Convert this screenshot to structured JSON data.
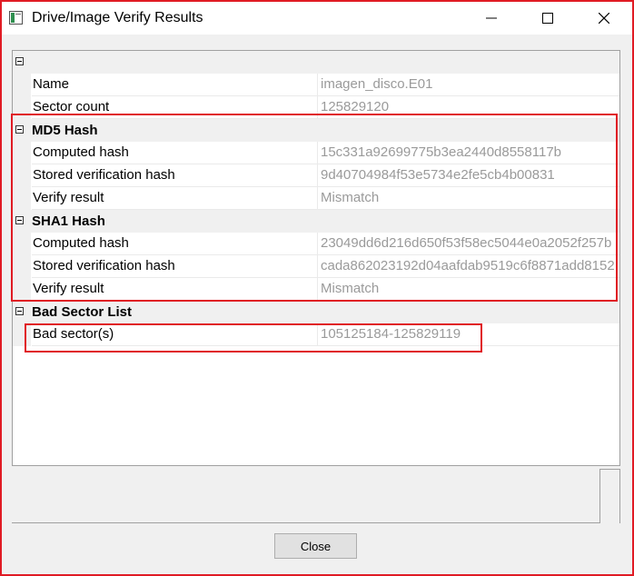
{
  "window": {
    "title": "Drive/Image Verify Results",
    "icons": {
      "app": "app-window-icon",
      "minimize": "minimize-icon",
      "maximize": "maximize-icon",
      "close": "close-icon"
    }
  },
  "properties": {
    "general": {
      "rows": [
        {
          "name": "Name",
          "value": "imagen_disco.E01"
        },
        {
          "name": "Sector count",
          "value": "125829120"
        }
      ]
    },
    "md5": {
      "label": "MD5 Hash",
      "rows": [
        {
          "name": "Computed hash",
          "value": "15c331a92699775b3ea2440d8558117b"
        },
        {
          "name": "Stored verification hash",
          "value": "9d40704984f53e5734e2fe5cb4b00831"
        },
        {
          "name": "Verify result",
          "value": "Mismatch"
        }
      ]
    },
    "sha1": {
      "label": "SHA1 Hash",
      "rows": [
        {
          "name": "Computed hash",
          "value": "23049dd6d216d650f53f58ec5044e0a2052f257b"
        },
        {
          "name": "Stored verification hash",
          "value": "cada862023192d04aafdab9519c6f8871add8152"
        },
        {
          "name": "Verify result",
          "value": "Mismatch"
        }
      ]
    },
    "bad_sectors": {
      "label": "Bad Sector List",
      "rows": [
        {
          "name": "Bad sector(s)",
          "value": "105125184-125829119"
        }
      ]
    }
  },
  "buttons": {
    "close_label": "Close"
  },
  "colors": {
    "highlight": "#e01b24",
    "value_text": "#9a9a9a",
    "grid_bg": "#f0f0f0"
  }
}
